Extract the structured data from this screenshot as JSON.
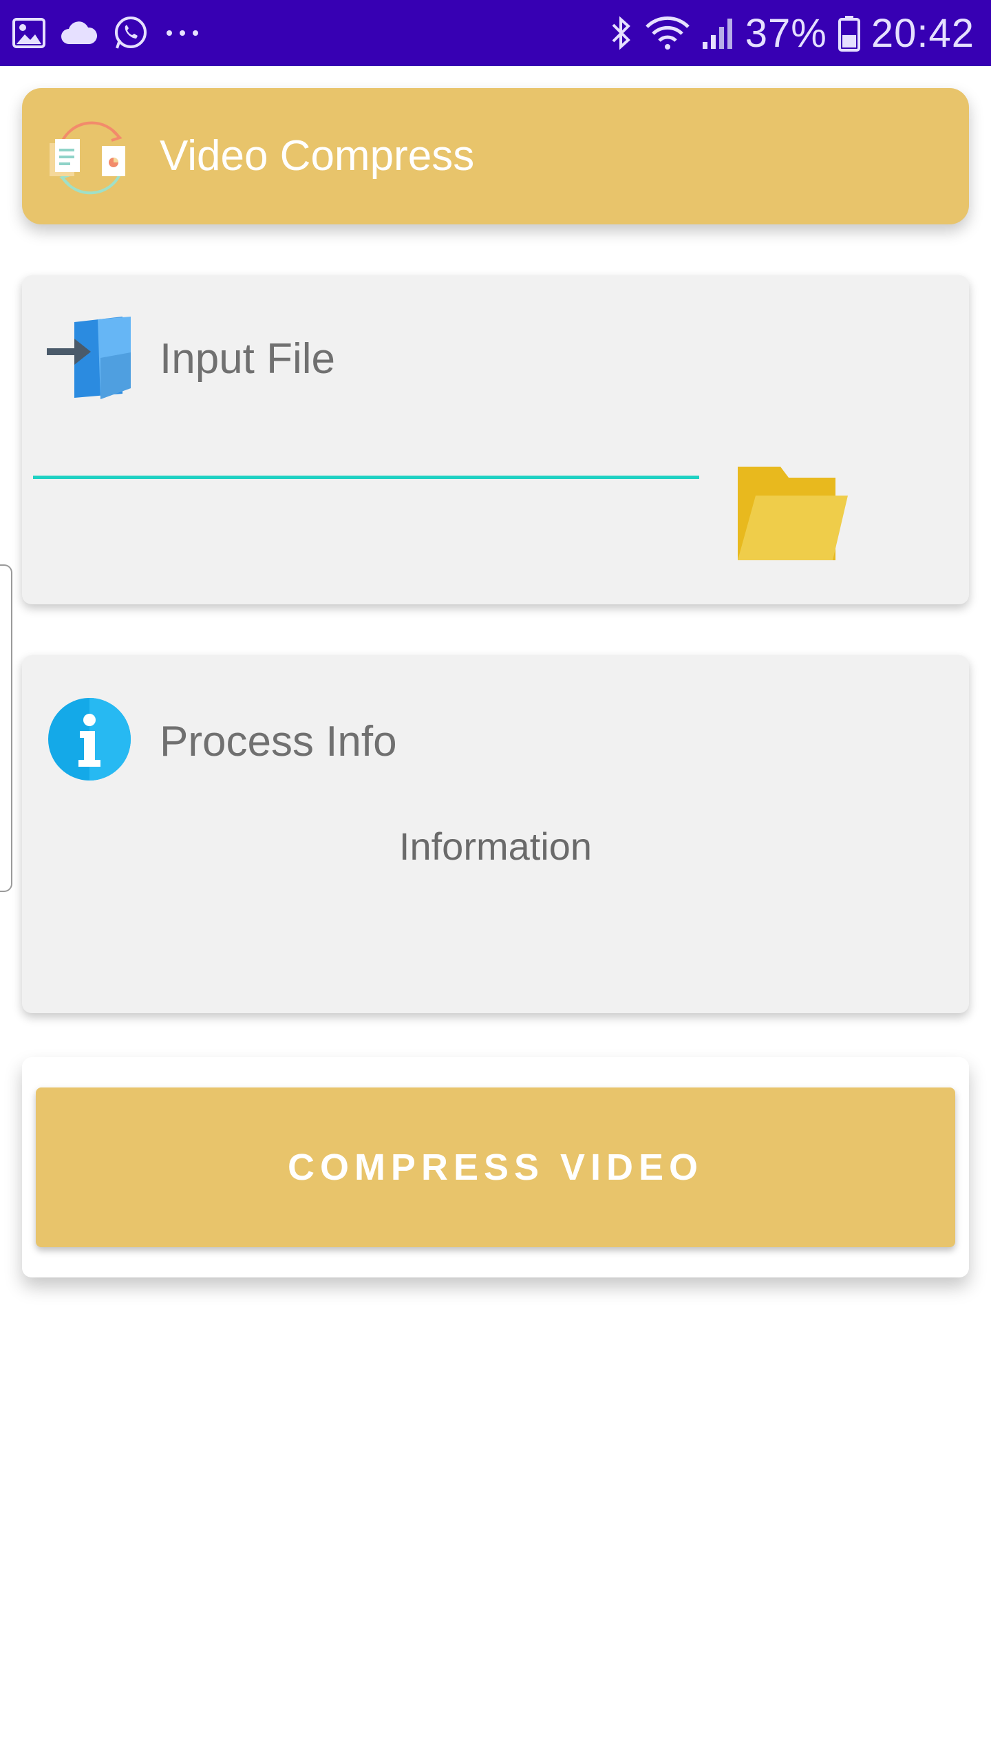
{
  "status_bar": {
    "battery": "37%",
    "time": "20:42",
    "icons": [
      "gallery-icon",
      "cloud-icon",
      "whatsapp-icon",
      "more-icon",
      "bluetooth-icon",
      "wifi-icon",
      "signal-icon",
      "battery-icon"
    ]
  },
  "app_bar": {
    "title": "Video Compress",
    "logo_icon": "convert-files-icon",
    "color": "#e8c46b"
  },
  "input_card": {
    "title": "Input File",
    "icon": "import-icon",
    "field_value": "",
    "folder_icon": "folder-icon",
    "underline_color": "#1fd1c3"
  },
  "info_card": {
    "title": "Process Info",
    "icon": "info-icon",
    "info_text": "Information"
  },
  "actions": {
    "compress_label": "COMPRESS VIDEO"
  },
  "colors": {
    "status_bar": "#3700b3",
    "accent": "#e8c46b",
    "card_bg": "#f1f1f1",
    "text_muted": "#707070"
  }
}
